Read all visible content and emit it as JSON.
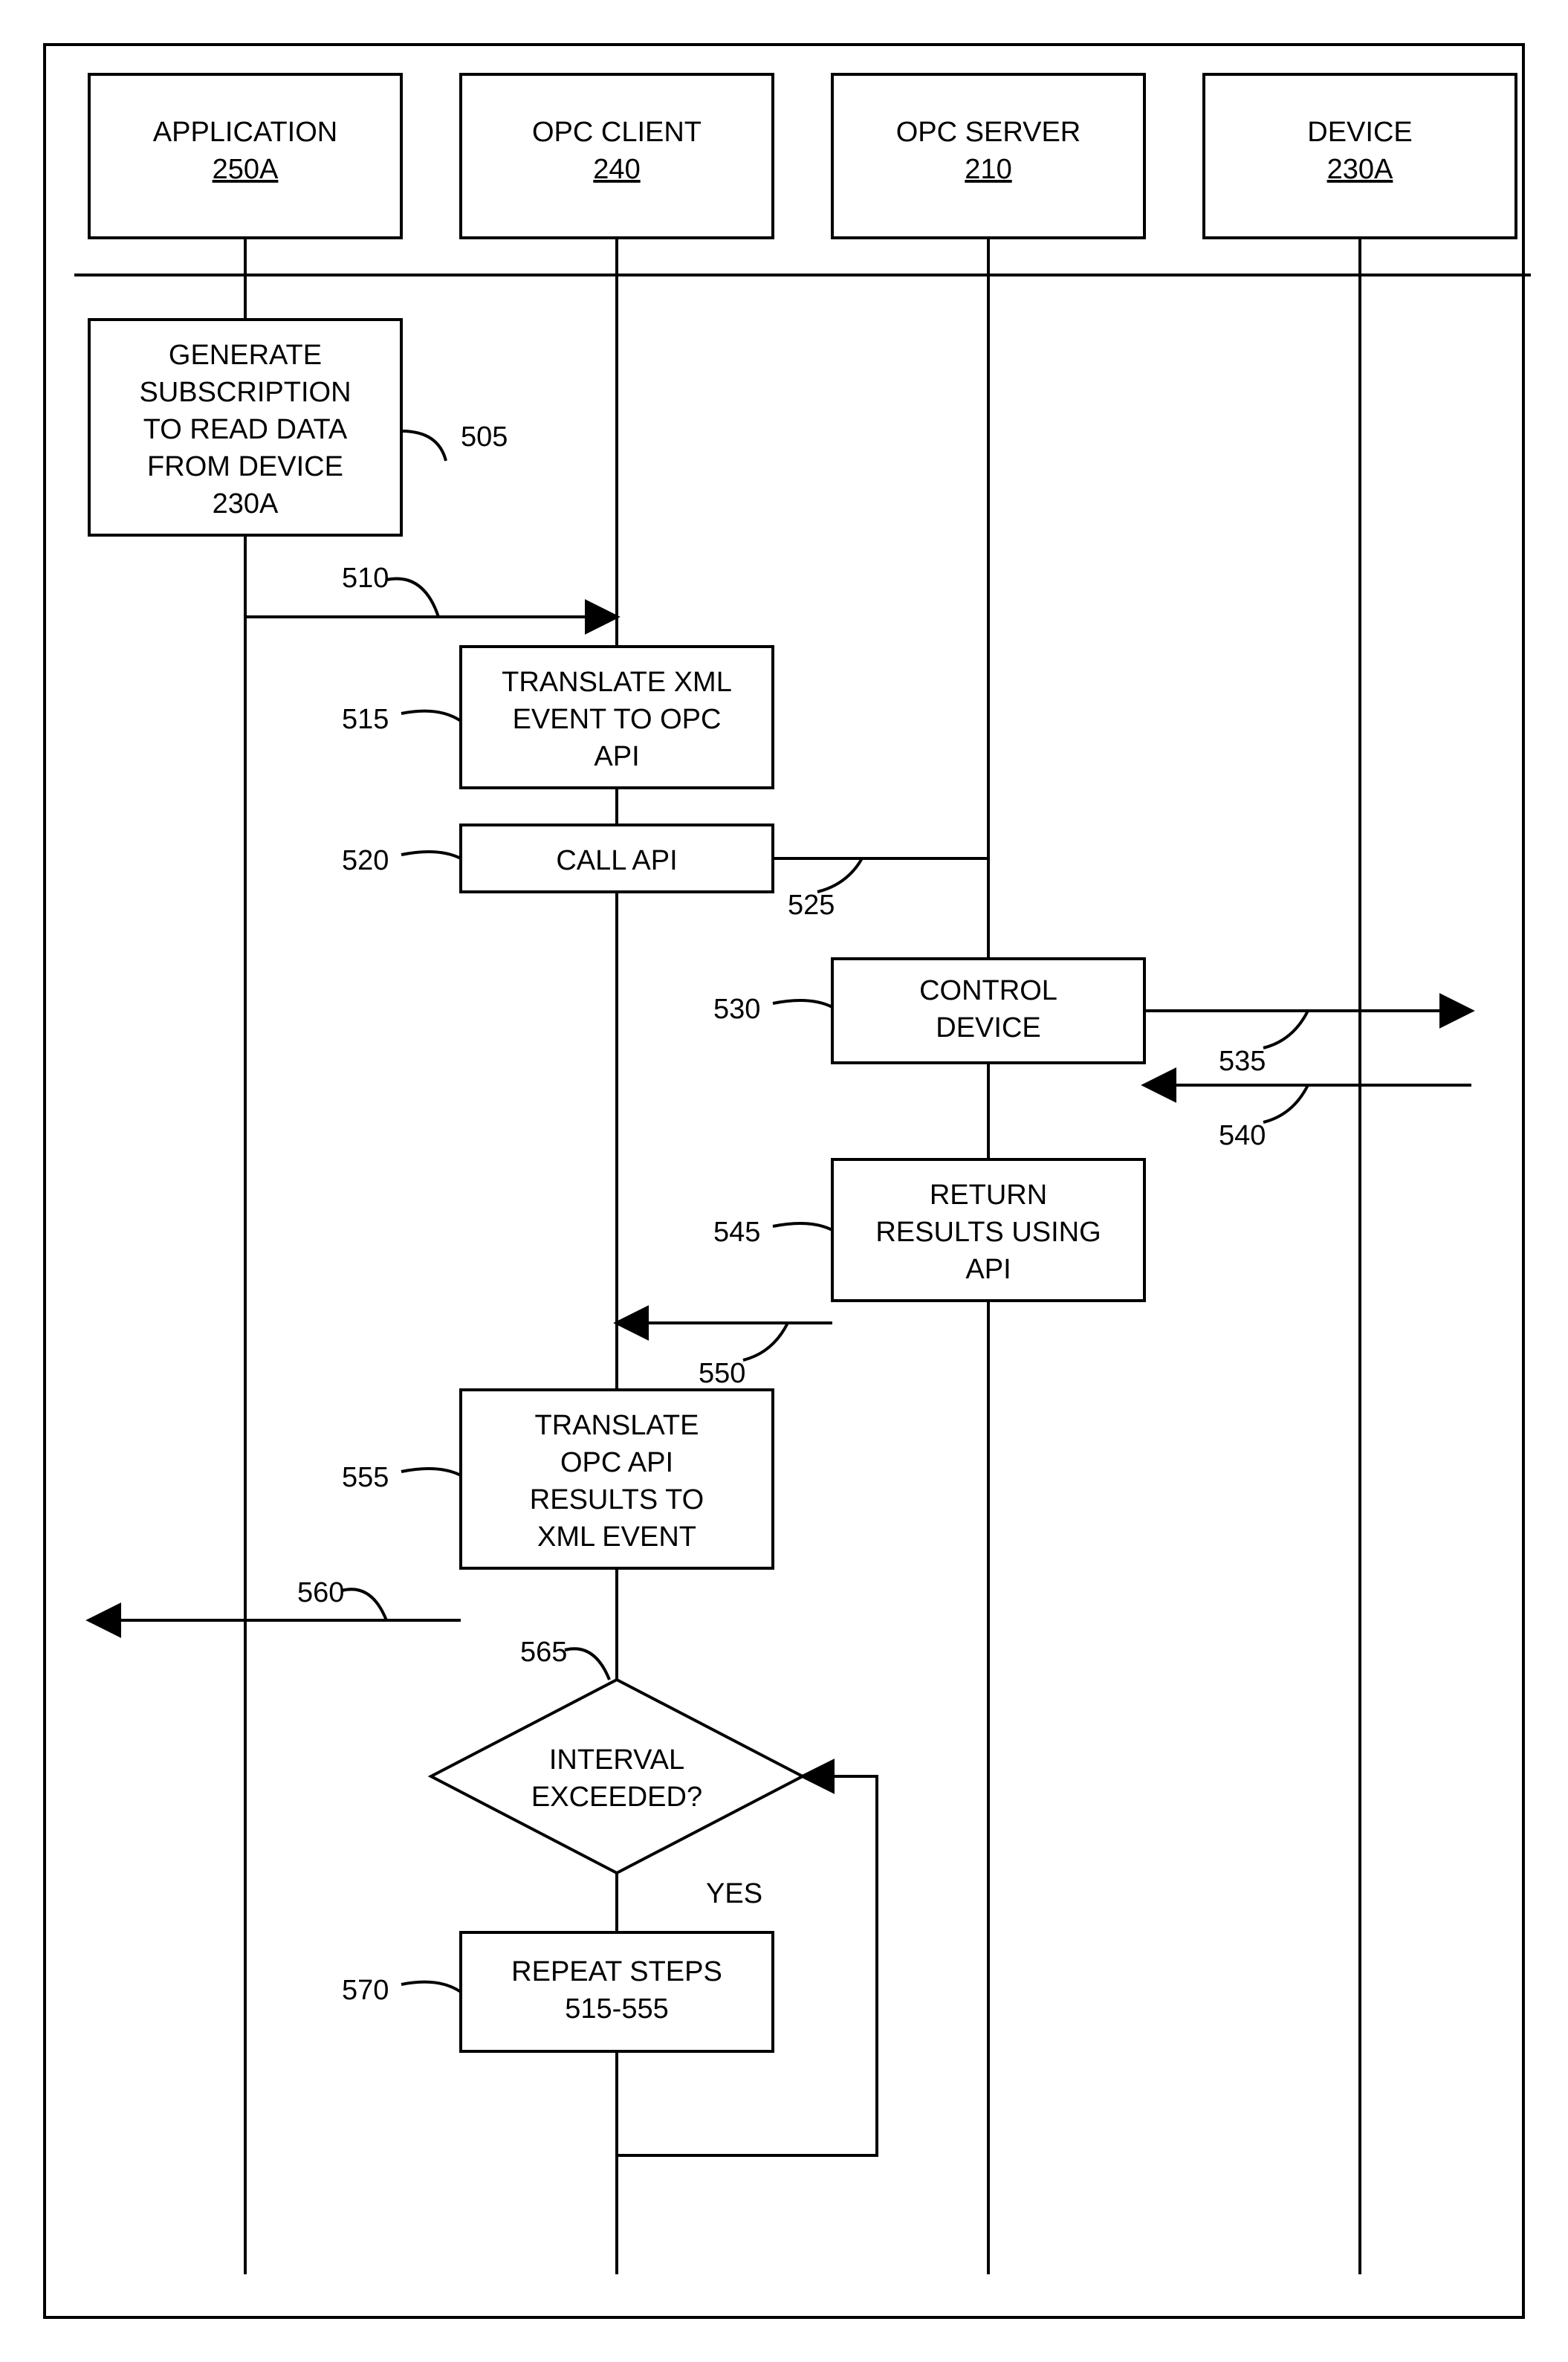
{
  "lanes": {
    "application": {
      "title": "APPLICATION",
      "ref": "250A"
    },
    "opc_client": {
      "title": "OPC CLIENT",
      "ref": "240"
    },
    "opc_server": {
      "title": "OPC SERVER",
      "ref": "210"
    },
    "device": {
      "title": "DEVICE",
      "ref": "230A"
    }
  },
  "steps": {
    "s505": {
      "label": "505",
      "text": [
        "GENERATE",
        "SUBSCRIPTION",
        "TO READ DATA",
        "FROM DEVICE",
        "230A"
      ]
    },
    "s510": {
      "label": "510"
    },
    "s515": {
      "label": "515",
      "text": [
        "TRANSLATE XML",
        "EVENT TO OPC",
        "API"
      ]
    },
    "s520": {
      "label": "520",
      "text": [
        "CALL API"
      ]
    },
    "s525": {
      "label": "525"
    },
    "s530": {
      "label": "530",
      "text": [
        "CONTROL",
        "DEVICE"
      ]
    },
    "s535": {
      "label": "535"
    },
    "s540": {
      "label": "540"
    },
    "s545": {
      "label": "545",
      "text": [
        "RETURN",
        "RESULTS USING",
        "API"
      ]
    },
    "s550": {
      "label": "550"
    },
    "s555": {
      "label": "555",
      "text": [
        "TRANSLATE",
        "OPC API",
        "RESULTS TO",
        "XML EVENT"
      ]
    },
    "s560": {
      "label": "560"
    },
    "s565": {
      "label": "565",
      "text": [
        "INTERVAL",
        "EXCEEDED?"
      ],
      "yes": "YES"
    },
    "s570": {
      "label": "570",
      "text": [
        "REPEAT STEPS",
        "515-555"
      ]
    }
  }
}
